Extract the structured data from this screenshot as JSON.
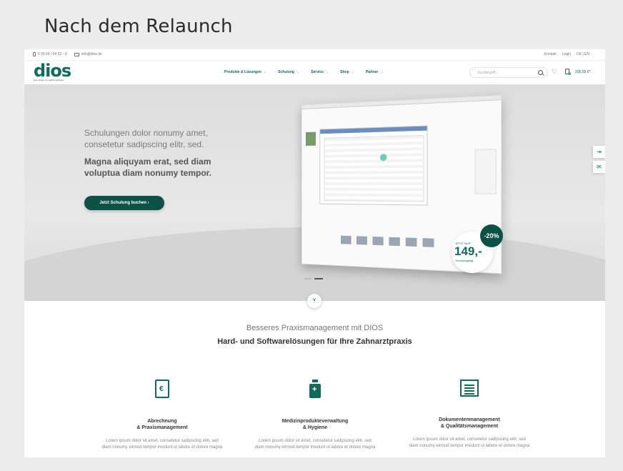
{
  "slide_title": "Nach dem Relaunch",
  "topbar": {
    "phone": "0 28 64 / 94 92 - 0",
    "email": "info@dios.de",
    "links": [
      "Kontakt",
      "Login",
      "DE | EN"
    ]
  },
  "header": {
    "logo": "dios",
    "logo_tagline": "Eine Marke von agilitis software",
    "nav": [
      {
        "label": "Produkte & Lösungen"
      },
      {
        "label": "Schulung"
      },
      {
        "label": "Service"
      },
      {
        "label": "Shop"
      },
      {
        "label": "Partner"
      }
    ],
    "search_placeholder": "Suchbegriff...",
    "cart_total": "205,59 €*"
  },
  "hero": {
    "line1": "Schulungen dolor nonumy amet, consetetur sadipscing elitr, sed.",
    "line2": "Magna aliquyam erat, sed diam voluptua diam nonumy tempor.",
    "button": "Jetzt Schulung buchen  ›",
    "price_prefix": "JETZT NUR",
    "price": "149,-",
    "price_unit": "/Schulungstag",
    "discount": "-20%"
  },
  "section": {
    "subtitle": "Besseres Praxismanagement mit DIOS",
    "title": "Hard- und Softwarelösungen für Ihre Zahnarztpraxis"
  },
  "features": [
    {
      "icon": "euro-document-icon",
      "title": "Abrechnung\n& Praxismanagement",
      "text": "Lorem ipsum dolor sit amet, consetetur sadipscing elitr, sed diam nonumy eirmod tempor invidunt ut labore et dolore magna"
    },
    {
      "icon": "medicine-bottle-icon",
      "title": "Medizinprodukteverwaltung\n& Hygiene",
      "text": "Lorem ipsum dolor sit amet, consetetur sadipscing elitr, sed diam nonumy eirmod tempor invidunt ut labore et dolore magna"
    },
    {
      "icon": "document-stack-icon",
      "title": "Dokumentenmanagement\n& Qualitätsmanagement",
      "text": "Lorem ipsum dolor sit amet, consetetur sadipscing elitr, sed diam nonumy eirmod tempor invidunt ut labore et dolore magna"
    }
  ],
  "colors": {
    "brand": "#0f6b5c",
    "brand_dark": "#0b5146"
  }
}
